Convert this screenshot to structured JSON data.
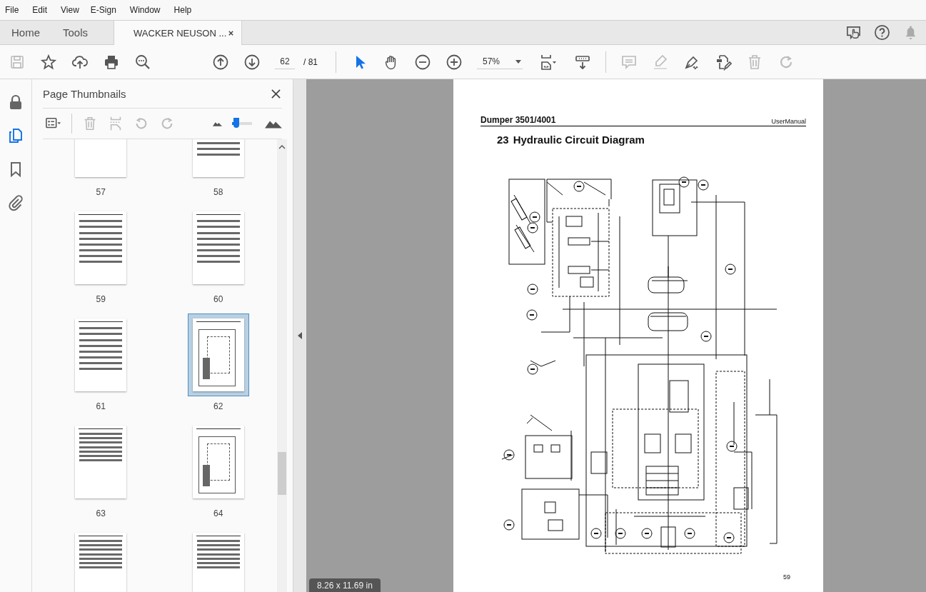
{
  "menu": [
    "File",
    "Edit",
    "View",
    "E-Sign",
    "Window",
    "Help"
  ],
  "tabs": [
    {
      "label": "Home",
      "selected": false,
      "closable": false
    },
    {
      "label": "Tools",
      "selected": false,
      "closable": false
    },
    {
      "label": "WACKER NEUSON ...",
      "selected": true,
      "closable": true
    }
  ],
  "tab_bar_tools": [
    {
      "kind": "share",
      "disabled": false
    },
    {
      "kind": "help",
      "disabled": false
    },
    {
      "kind": "notifications",
      "disabled": true
    }
  ],
  "toolbar": {
    "groups": [
      {
        "items": [
          {
            "kind": "save",
            "disabled": true,
            "selected": false
          },
          {
            "kind": "star",
            "disabled": false,
            "selected": false
          },
          {
            "kind": "upload",
            "disabled": false,
            "selected": false
          },
          {
            "kind": "print",
            "disabled": false,
            "selected": false
          },
          {
            "kind": "find",
            "disabled": false,
            "selected": false
          }
        ]
      },
      {
        "items": [
          {
            "kind": "prev-page",
            "disabled": false,
            "selected": false
          },
          {
            "kind": "next-page",
            "disabled": false,
            "selected": false
          },
          {
            "kind": "page-input",
            "current": "62",
            "separator": "/",
            "total": "81"
          }
        ]
      },
      {
        "items": [
          {
            "kind": "select",
            "disabled": false,
            "selected": true
          },
          {
            "kind": "hand",
            "disabled": false,
            "selected": false
          },
          {
            "kind": "zoom-out",
            "disabled": false,
            "selected": false
          },
          {
            "kind": "zoom-in",
            "disabled": false,
            "selected": false
          },
          {
            "kind": "zoom-select",
            "value": "57%"
          },
          {
            "kind": "fit-page",
            "disabled": false,
            "selected": false
          },
          {
            "kind": "scroll-mode",
            "disabled": false,
            "selected": false
          }
        ]
      },
      {
        "items": [
          {
            "kind": "comment",
            "disabled": true,
            "selected": false
          },
          {
            "kind": "highlight",
            "disabled": true,
            "selected": false
          },
          {
            "kind": "sign",
            "disabled": false,
            "selected": false
          },
          {
            "kind": "edit-pages",
            "disabled": false,
            "selected": false
          },
          {
            "kind": "delete",
            "disabled": true,
            "selected": false
          },
          {
            "kind": "redo",
            "disabled": true,
            "selected": false
          }
        ]
      }
    ]
  },
  "rail": [
    {
      "kind": "lock",
      "selected": false
    },
    {
      "kind": "pages",
      "selected": true
    },
    {
      "kind": "bookmark",
      "selected": false
    },
    {
      "kind": "attachment",
      "selected": false
    }
  ],
  "panel": {
    "title": "Page Thumbnails",
    "tools": [
      {
        "kind": "options",
        "disabled": false
      },
      {
        "kind": "delete",
        "disabled": true
      },
      {
        "kind": "insert",
        "disabled": true
      },
      {
        "kind": "rotate-left",
        "disabled": true
      },
      {
        "kind": "rotate-right",
        "disabled": true
      }
    ],
    "size_slider": {
      "level": 0.2
    },
    "thumbnails": [
      {
        "label": "57",
        "selected": false,
        "kind": "text"
      },
      {
        "label": "58",
        "selected": false,
        "kind": "table"
      },
      {
        "label": "59",
        "selected": false,
        "kind": "table"
      },
      {
        "label": "60",
        "selected": false,
        "kind": "table"
      },
      {
        "label": "61",
        "selected": false,
        "kind": "table"
      },
      {
        "label": "62",
        "selected": true,
        "kind": "diagram"
      },
      {
        "label": "63",
        "selected": false,
        "kind": "list"
      },
      {
        "label": "64",
        "selected": false,
        "kind": "diagram"
      },
      {
        "kind": "list",
        "selected": false
      },
      {
        "kind": "list",
        "selected": false
      }
    ]
  },
  "document": {
    "header_left": "Dumper 3501/4001",
    "header_right": "UserManual",
    "heading_number": "23",
    "heading_title": "Hydraulic Circuit Diagram",
    "page_number": "59",
    "page_size": "8.26 x 11.69 in"
  }
}
